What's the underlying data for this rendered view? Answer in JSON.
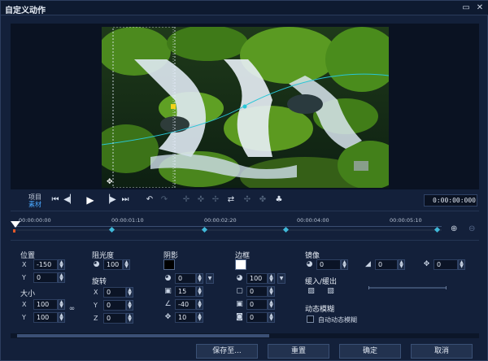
{
  "window": {
    "title": "自定义动作",
    "restore_icon": "restore-icon",
    "close_icon": "close-icon"
  },
  "playback": {
    "project_label": "项目",
    "clip_label": "素材",
    "timecode": "0:00:00:000"
  },
  "timeline": {
    "ticks": [
      "00:00:00:00",
      "00:00:01:10",
      "00:00:02:20",
      "00:00:04:00",
      "00:00:05:10"
    ]
  },
  "position": {
    "title": "位置",
    "x_label": "X",
    "x_value": "-150",
    "y_label": "Y",
    "y_value": "0"
  },
  "size": {
    "title": "大小",
    "x_label": "X",
    "x_value": "100",
    "y_label": "Y",
    "y_value": "100"
  },
  "opacity": {
    "title": "阻光度",
    "value": "100"
  },
  "rotation": {
    "title": "旋转",
    "x_label": "X",
    "x_value": "0",
    "y_label": "Y",
    "y_value": "0",
    "z_label": "Z",
    "z_value": "0"
  },
  "shadow": {
    "title": "阴影",
    "color": "#000000",
    "v1": "0",
    "v2": "15",
    "v3": "-40",
    "v4": "10"
  },
  "border": {
    "title": "边框",
    "color": "#ffffff",
    "v1": "100",
    "v2": "0",
    "v3": "0",
    "v4": "0"
  },
  "mirror": {
    "title": "镜像",
    "v1": "0",
    "v2": "0",
    "v3": "0"
  },
  "ease": {
    "title": "缓入/缓出"
  },
  "motion_blur": {
    "title": "动态模糊",
    "auto_label": "自动动态模糊",
    "auto_checked": false
  },
  "footer": {
    "save_as": "保存至...",
    "reset": "重置",
    "ok": "确定",
    "cancel": "取消"
  }
}
